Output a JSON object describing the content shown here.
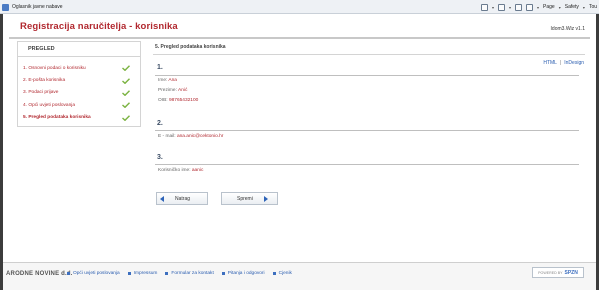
{
  "browser": {
    "tab_title": "Oglasnik javne nabave",
    "tools": [
      {
        "icon": "home-icon"
      },
      {
        "icon": "feeds-icon"
      },
      {
        "icon": "mail-icon"
      },
      {
        "icon": "print-icon"
      }
    ],
    "page_menu": "Page",
    "safety_menu": "Safety",
    "tools_menu": "Tou"
  },
  "header": {
    "title": "Registracija naručitelja - korisnika",
    "version": "Idom3.Wiz v1.1"
  },
  "sidebar": {
    "title": "PREGLED",
    "steps": [
      {
        "label": "1. Osnovni podaci o korisniku",
        "done": true
      },
      {
        "label": "2. E-pošta korisnika",
        "done": true
      },
      {
        "label": "3. Podaci prijave",
        "done": true
      },
      {
        "label": "4. Opći uvjeti poslovanja",
        "done": true
      },
      {
        "label": "5. Pregled podataka korisnika",
        "done": true,
        "active": true
      }
    ]
  },
  "main": {
    "heading": "5. Pregled podataka korisnika",
    "export": {
      "html": "HTML",
      "sep": "|",
      "indesign": "InDesign"
    },
    "section1": {
      "num": "1.",
      "ime_label": "Ime:",
      "ime_value": "Ana",
      "prezime_label": "Prezime:",
      "prezime_value": "Anić",
      "oib_label": "OIB:",
      "oib_value": "98765432100"
    },
    "section2": {
      "num": "2.",
      "email_label": "E - mail:",
      "email_value": "ana.anic@cektonio.hr"
    },
    "section3": {
      "num": "3.",
      "user_label": "Korisničko ime:",
      "user_value": "aanic"
    },
    "back_label": "Natrag",
    "next_label": "Spremi"
  },
  "footer": {
    "brand": "ARODNE NOVINE d.d.",
    "links": [
      "Opći uvjeti poslovanja",
      "Impressum",
      "Formular za kontakt",
      "Pitanja i odgovori",
      "Cjenik"
    ],
    "powered_label": "POWERED BY",
    "powered_brand": "SPZN"
  },
  "colors": {
    "accent": "#b1282f",
    "link": "#2a5db0",
    "heading_blue": "#3d4e66",
    "check": "#7cb342"
  }
}
